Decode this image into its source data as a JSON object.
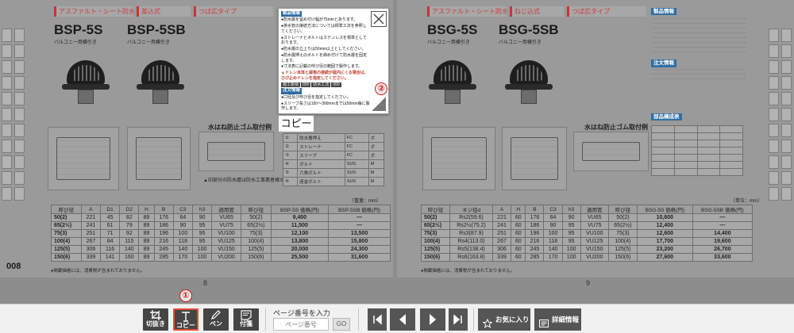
{
  "viewer": {
    "left_page": {
      "number": "8",
      "footer_page": "008",
      "footnote": "●掲載価格には、消費税が含まれておりません。",
      "tags": [
        "アスファルト・シート防水",
        "差込式",
        "つば広タイプ"
      ],
      "products": [
        {
          "code": "BSP-5S",
          "subtitle": "バルコニー用横引き"
        },
        {
          "code": "BSP-5SB",
          "subtitle": "バルコニー用横引き"
        }
      ],
      "diagram_title": "水はね防止ゴム取付例",
      "diagram_note": "▲印部分の防水層は防水工事業者様が施工してください。",
      "parts": [
        [
          "①",
          "防水層押え",
          "FC",
          "ボ"
        ],
        [
          "②",
          "ストレーナ",
          "FC",
          "ボ"
        ],
        [
          "③",
          "スリーブ",
          "FC",
          "ボ"
        ],
        [
          "④",
          "ボルト",
          "SUS",
          "M"
        ],
        [
          "⑤",
          "六角ボルト",
          "SUS",
          "M"
        ],
        [
          "⑥",
          "座金ボルト",
          "SUS",
          "M"
        ]
      ],
      "unit": "（重量：mm）",
      "spec_headers": [
        "呼び径",
        "A",
        "D1",
        "D2",
        "H",
        "B",
        "C3",
        "h3",
        "適用管",
        "呼び径",
        "BSP-5S 価格(円)",
        "BSP-5SB 価格(円)"
      ],
      "spec_rows": [
        [
          "50(2)",
          "221",
          "45",
          "82",
          "89",
          "176",
          "64",
          "90",
          "VU65",
          "50(2)",
          "9,400",
          "—"
        ],
        [
          "65(2½)",
          "241",
          "61",
          "79",
          "89",
          "186",
          "90",
          "95",
          "VU75",
          "65(2½)",
          "11,500",
          "—"
        ],
        [
          "75(3)",
          "251",
          "71",
          "92",
          "89",
          "196",
          "100",
          "95",
          "VU100",
          "75(3)",
          "12,100",
          "13,500"
        ],
        [
          "100(4)",
          "267",
          "84",
          "115",
          "89",
          "216",
          "118",
          "95",
          "VU125",
          "100(4)",
          "13,800",
          "15,800"
        ],
        [
          "125(5)",
          "306",
          "116",
          "140",
          "89",
          "245",
          "140",
          "100",
          "VU150",
          "125(5)",
          "20,000",
          "24,300"
        ],
        [
          "150(6)",
          "339",
          "141",
          "160",
          "89",
          "285",
          "170",
          "100",
          "VU200",
          "150(6)",
          "25,500",
          "31,600"
        ]
      ]
    },
    "right_page": {
      "number": "9",
      "footnote": "●掲載価格には、消費税が含まれておりません。",
      "tags": [
        "アスファルト・シート防水",
        "ねじ込式",
        "つば広タイプ"
      ],
      "products": [
        {
          "code": "BSG-5S",
          "subtitle": "バルコニー用横引き"
        },
        {
          "code": "BSG-5SB",
          "subtitle": "バルコニー用横引き"
        }
      ],
      "diagram_title": "水はね防止ゴム取付例",
      "info_heading": "製品情報",
      "order_heading": "注文情報",
      "parts_heading": "部品構成表",
      "unit": "（単位：mm）",
      "spec_headers": [
        "呼び径",
        "ネジ径d",
        "A",
        "H",
        "B",
        "C3",
        "h3",
        "適用管",
        "呼び径",
        "BSG-5S 価格(円)",
        "BSG-5SB 価格(円)"
      ],
      "spec_rows": [
        [
          "50(2)",
          "Rs2(59.6)",
          "221",
          "60",
          "176",
          "64",
          "90",
          "VU65",
          "50(2)",
          "10,600",
          "—"
        ],
        [
          "65(2½)",
          "Rs2½(75.2)",
          "241",
          "60",
          "186",
          "90",
          "95",
          "VU75",
          "65(2½)",
          "12,400",
          "—"
        ],
        [
          "75(3)",
          "Rs3(87.9)",
          "251",
          "60",
          "196",
          "100",
          "95",
          "VU100",
          "75(3)",
          "12,600",
          "14,400"
        ],
        [
          "100(4)",
          "Rs4(113.0)",
          "267",
          "60",
          "216",
          "118",
          "95",
          "VU125",
          "100(4)",
          "17,700",
          "19,600"
        ],
        [
          "125(5)",
          "Rs5(138.4)",
          "306",
          "60",
          "245",
          "140",
          "100",
          "VU150",
          "125(5)",
          "23,200",
          "26,700"
        ],
        [
          "150(6)",
          "Rs6(163.8)",
          "339",
          "60",
          "285",
          "170",
          "100",
          "VU200",
          "150(6)",
          "27,600",
          "33,600"
        ]
      ]
    }
  },
  "popup": {
    "heading_info": "製品情報",
    "lines": [
      "●防水層を留め付け幅が75mmとあります。",
      "●排水管の接続方法については標準工法を参照してください。",
      "●ストレーナとボルトはステンレスを標準としております。",
      "●防水層の立上りは50mm以上としてください。",
      "●防水層押えのボルトを締め付けて防水層を固定します。",
      "●寸法表に記載の呼び径の範囲で製作します。"
    ],
    "warning": "▲ドレン本体と屋根の接続が屋内にくる場合は、ひび止めドレンを指定してください。",
    "mini_tags": [
      "施工要領",
      "000",
      "防水工法",
      "000"
    ],
    "heading_order": "注文情報",
    "order_lines": [
      "●口径及び呼び径を指定してください。",
      "●スリーブ長さは150～300mmまでは50mm毎に製作します。"
    ],
    "copy_label": "コピー",
    "badge": "②"
  },
  "toolbar": {
    "crop_label": "切抜き",
    "copy_label": "コピー",
    "pen_label": "ペン",
    "sticky_label": "付箋",
    "page_input_label": "ページ番号を入力",
    "page_input_placeholder": "ページ番号",
    "go_label": "GO",
    "favorites_label": "お気に入り",
    "details_label": "詳細情報",
    "badge": "①"
  },
  "colors": {
    "highlight_red": "#e64a3a",
    "toolbar_button": "#454545",
    "info_blue": "#2f6fa3"
  }
}
